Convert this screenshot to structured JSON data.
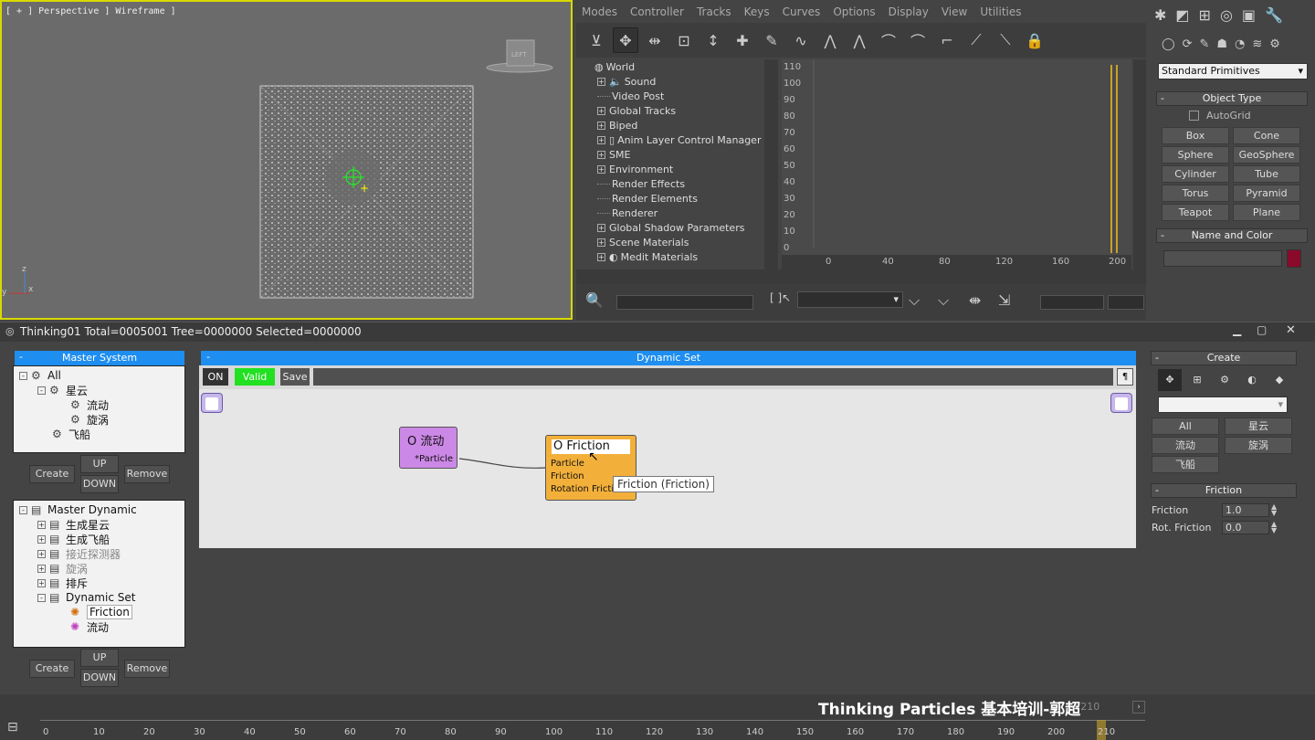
{
  "viewport": {
    "label": "[ + ] Perspective ] Wireframe ]",
    "cube_label": "LEFT",
    "axis_x": "x",
    "axis_y": "y",
    "axis_z": "z"
  },
  "trackview": {
    "menu": [
      "Modes",
      "Controller",
      "Tracks",
      "Keys",
      "Curves",
      "Options",
      "Display",
      "View",
      "Utilities"
    ],
    "tree": [
      {
        "label": "World",
        "expand": false,
        "root": true
      },
      {
        "label": "Sound",
        "expand": true
      },
      {
        "label": "Video Post",
        "expand": false
      },
      {
        "label": "Global Tracks",
        "expand": true
      },
      {
        "label": "Biped",
        "expand": true
      },
      {
        "label": "Anim Layer Control Manager",
        "expand": true
      },
      {
        "label": "SME",
        "expand": true
      },
      {
        "label": "Environment",
        "expand": true
      },
      {
        "label": "Render Effects",
        "expand": false
      },
      {
        "label": "Render Elements",
        "expand": false
      },
      {
        "label": "Renderer",
        "expand": false
      },
      {
        "label": "Global Shadow Parameters",
        "expand": true
      },
      {
        "label": "Scene Materials",
        "expand": true
      },
      {
        "label": "Medit Materials",
        "expand": true
      }
    ],
    "y_ticks": [
      "110",
      "100",
      "90",
      "80",
      "70",
      "60",
      "50",
      "40",
      "30",
      "20",
      "10",
      "0"
    ],
    "x_ticks": [
      "0",
      "40",
      "80",
      "120",
      "160",
      "200"
    ]
  },
  "command_panel": {
    "dropdown": "Standard Primitives",
    "object_type_title": "Object Type",
    "autogrid": "AutoGrid",
    "buttons": [
      "Box",
      "Cone",
      "Sphere",
      "GeoSphere",
      "Cylinder",
      "Tube",
      "Torus",
      "Pyramid",
      "Teapot",
      "Plane"
    ],
    "name_color_title": "Name and Color",
    "name_value": "",
    "accent": "#8a0a2a"
  },
  "tp": {
    "title": "Thinking01  Total=0005001  Tree=0000000  Selected=0000000",
    "master_system_title": "Master System",
    "master_system_tree": [
      {
        "label": "All",
        "level": 0,
        "expand": "-"
      },
      {
        "label": "星云",
        "level": 1,
        "expand": "-"
      },
      {
        "label": "流动",
        "level": 2,
        "expand": ""
      },
      {
        "label": "旋涡",
        "level": 2,
        "expand": ""
      },
      {
        "label": "飞船",
        "level": 1,
        "expand": ""
      }
    ],
    "btn_create": "Create",
    "btn_up": "UP",
    "btn_down": "DOWN",
    "btn_remove": "Remove",
    "master_dynamic_tree": [
      {
        "label": "Master Dynamic",
        "level": 0,
        "expand": "-",
        "type": "doc"
      },
      {
        "label": "生成星云",
        "level": 1,
        "expand": "+",
        "type": "doc"
      },
      {
        "label": "生成飞船",
        "level": 1,
        "expand": "+",
        "type": "doc"
      },
      {
        "label": "接近探测器",
        "level": 1,
        "expand": "+",
        "type": "doc",
        "dim": true
      },
      {
        "label": "旋涡",
        "level": 1,
        "expand": "+",
        "type": "doc",
        "dim": true
      },
      {
        "label": "排斥",
        "level": 1,
        "expand": "+",
        "type": "doc"
      },
      {
        "label": "Dynamic Set",
        "level": 1,
        "expand": "-",
        "type": "doc"
      },
      {
        "label": "Friction",
        "level": 2,
        "expand": "",
        "type": "gear",
        "selected": true
      },
      {
        "label": "流动",
        "level": 2,
        "expand": "",
        "type": "gear"
      }
    ],
    "dynamic_set_title": "Dynamic Set",
    "btn_on": "ON",
    "btn_valid": "Valid",
    "btn_save": "Save",
    "node1": {
      "title": "O 流动",
      "port": "*Particle"
    },
    "node2": {
      "title": "O Friction",
      "ports": [
        "Particle",
        "Friction",
        "Rotation Friction"
      ]
    },
    "tooltip": "Friction (Friction)",
    "create_title": "Create",
    "create_items": [
      "All",
      "星云",
      "流动",
      "旋涡",
      "飞船"
    ],
    "friction_title": "Friction",
    "friction_label": "Friction",
    "friction_value": "1.0",
    "rot_friction_label": "Rot. Friction",
    "rot_friction_value": "0.0"
  },
  "timeline": {
    "frame_display": "/ 210",
    "ticks": [
      "0",
      "10",
      "20",
      "30",
      "40",
      "50",
      "60",
      "70",
      "80",
      "90",
      "100",
      "110",
      "120",
      "130",
      "140",
      "150",
      "160",
      "170",
      "180",
      "190",
      "200",
      "210"
    ],
    "watermark": "Thinking Particles 基本培训-郭超"
  }
}
